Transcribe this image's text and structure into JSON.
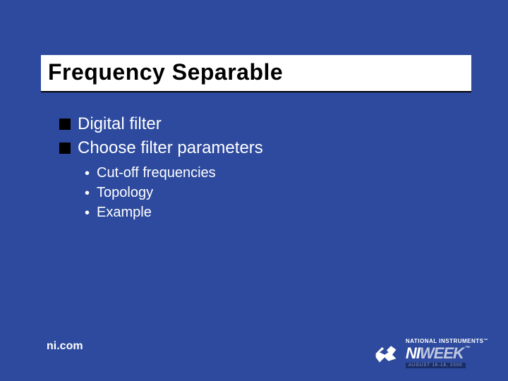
{
  "slide": {
    "title": "Frequency Separable",
    "bullets": [
      {
        "text": "Digital filter"
      },
      {
        "text": "Choose filter parameters"
      }
    ],
    "sub_bullets": [
      {
        "text": "Cut-off frequencies"
      },
      {
        "text": "Topology"
      },
      {
        "text": "Example"
      }
    ]
  },
  "footer": {
    "site": "ni.com",
    "brand_top": "NATIONAL INSTRUMENTS",
    "brand_ni": "NI",
    "brand_week": "WEEK",
    "tm": "™",
    "date": "AUGUST 16-18, 2000"
  }
}
